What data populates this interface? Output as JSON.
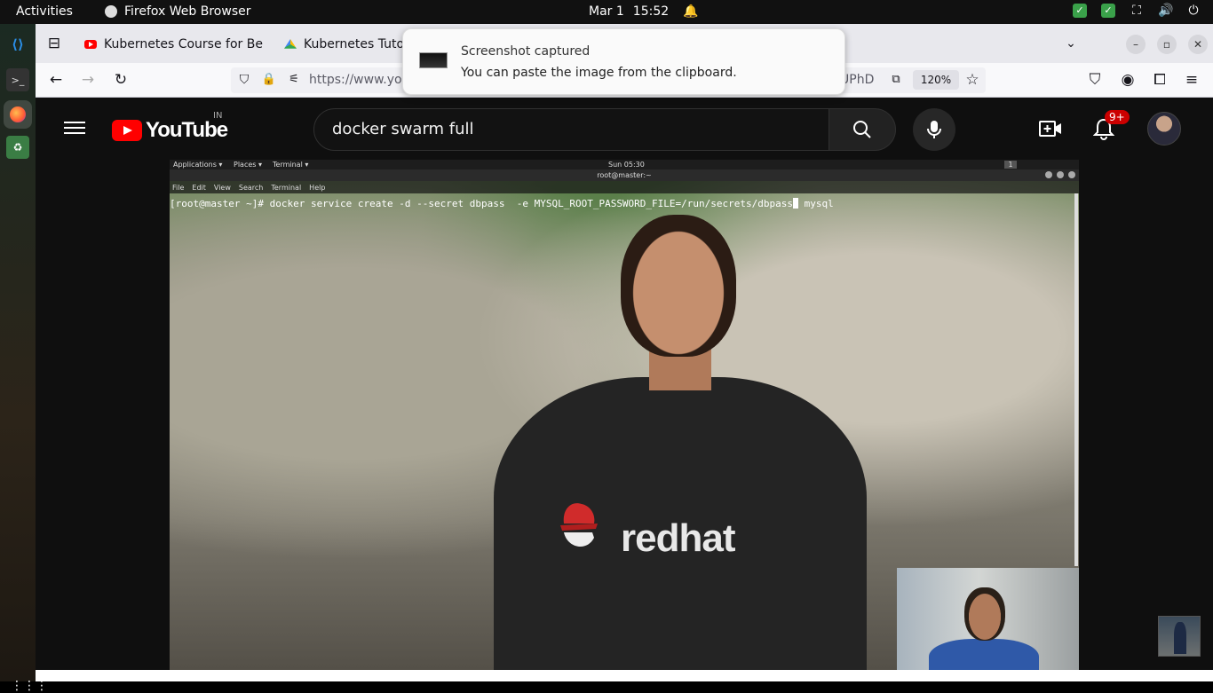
{
  "topbar": {
    "activities": "Activities",
    "app_name": "Firefox Web Browser",
    "date": "Mar 1",
    "time": "15:52"
  },
  "tabs": [
    {
      "title": "Kubernetes Course for Be"
    },
    {
      "title": "Kubernetes Tuto"
    }
  ],
  "navbar": {
    "url": "https://www.yo",
    "url_tail": "UPhD",
    "zoom": "120%"
  },
  "notification": {
    "title": "Screenshot captured",
    "body": "You can paste the image from the clipboard."
  },
  "youtube": {
    "logo": "YouTube",
    "region": "IN",
    "search_query": "docker swarm full",
    "notif_count": "9+"
  },
  "video_desktop": {
    "panel_apps": "Applications ▾",
    "panel_places": "Places ▾",
    "panel_terminal": "Terminal ▾",
    "panel_clock": "Sun 05:30",
    "workspace": "1",
    "window_title": "root@master:~",
    "menu": [
      "File",
      "Edit",
      "View",
      "Search",
      "Terminal",
      "Help"
    ],
    "command_before_cursor": "[root@master ~]# docker service create -d --secret dbpass  -e MYSQL_ROOT_PASSWORD_FILE=/run/secrets/dbpass",
    "command_after_cursor": " mysql",
    "shirt_text": "redhat"
  }
}
